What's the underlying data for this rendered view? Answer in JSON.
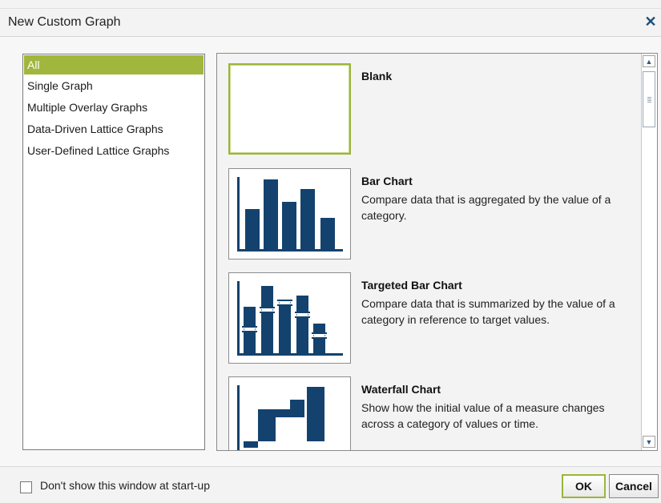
{
  "dialog": {
    "title": "New Custom Graph",
    "close_glyph": "✕"
  },
  "categories": [
    {
      "label": "All",
      "selected": true
    },
    {
      "label": "Single Graph",
      "selected": false
    },
    {
      "label": "Multiple Overlay Graphs",
      "selected": false
    },
    {
      "label": "Data-Driven Lattice Graphs",
      "selected": false
    },
    {
      "label": "User-Defined Lattice Graphs",
      "selected": false
    }
  ],
  "graphs": [
    {
      "title": "Blank",
      "description": "",
      "icon": "blank-icon",
      "selected": true
    },
    {
      "title": "Bar Chart",
      "description": "Compare data that is aggregated by the value of a category.",
      "icon": "bar-chart-icon",
      "selected": false
    },
    {
      "title": "Targeted Bar Chart",
      "description": "Compare data that is summarized by the value of a category in reference to target values.",
      "icon": "targeted-bar-chart-icon",
      "selected": false
    },
    {
      "title": "Waterfall Chart",
      "description": "Show how the initial value of a measure changes across a category of values or time.",
      "icon": "waterfall-chart-icon",
      "selected": false
    }
  ],
  "footer": {
    "checkbox_label": "Don't show this window at start-up",
    "checked": false,
    "ok_label": "OK",
    "cancel_label": "Cancel"
  },
  "colors": {
    "accent": "#a1b63c",
    "chart_fill": "#14426e"
  }
}
